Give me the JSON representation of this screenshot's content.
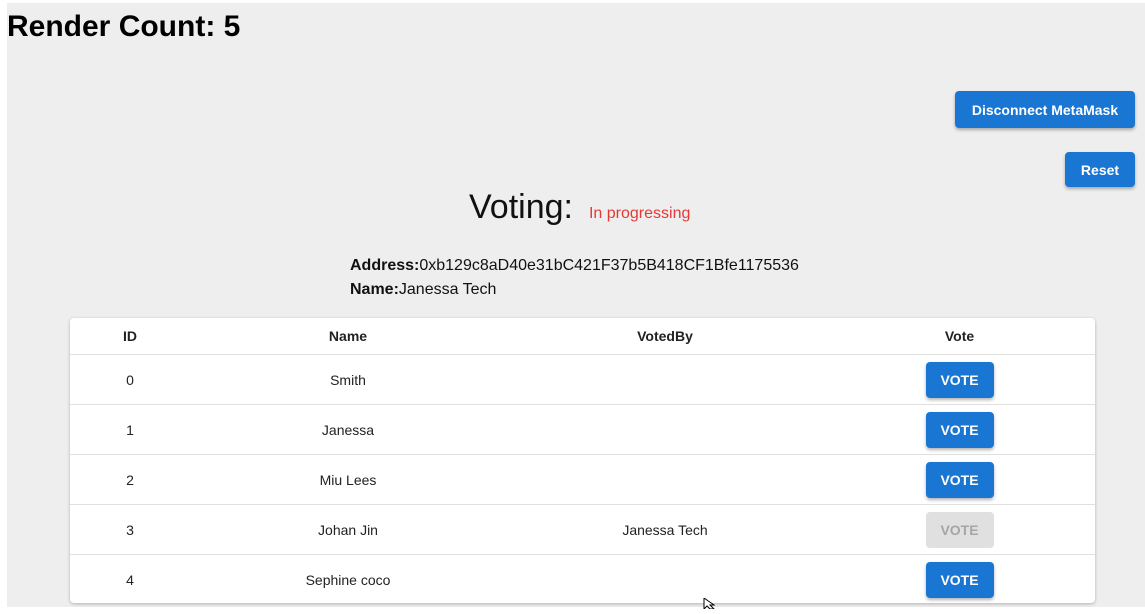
{
  "header": {
    "render_count": "Render Count: 5"
  },
  "buttons": {
    "disconnect": "Disconnect MetaMask",
    "reset": "Reset"
  },
  "voting": {
    "title": "Voting:",
    "status": "In progressing",
    "status_color": "#e53935"
  },
  "account": {
    "address_label": "Address:",
    "address_value": "0xb129c8aD40e31bC421F37b5B418CF1Bfe1175536",
    "name_label": "Name:",
    "name_value": "Janessa Tech"
  },
  "table": {
    "headers": {
      "id": "ID",
      "name": "Name",
      "voted_by": "VotedBy",
      "vote": "Vote"
    },
    "rows": [
      {
        "id": "0",
        "name": "Smith",
        "voted_by": "",
        "vote_label": "VOTE",
        "disabled": false
      },
      {
        "id": "1",
        "name": "Janessa",
        "voted_by": "",
        "vote_label": "VOTE",
        "disabled": false
      },
      {
        "id": "2",
        "name": "Miu Lees",
        "voted_by": "",
        "vote_label": "VOTE",
        "disabled": false
      },
      {
        "id": "3",
        "name": "Johan Jin",
        "voted_by": "Janessa Tech",
        "vote_label": "VOTE",
        "disabled": true
      },
      {
        "id": "4",
        "name": "Sephine coco",
        "voted_by": "",
        "vote_label": "VOTE",
        "disabled": false
      }
    ]
  },
  "colors": {
    "primary": "#1976d2",
    "background": "#eeeeee",
    "disabled_bg": "#e0e0e0"
  },
  "icons": {
    "cursor": "mouse-pointer-icon"
  }
}
